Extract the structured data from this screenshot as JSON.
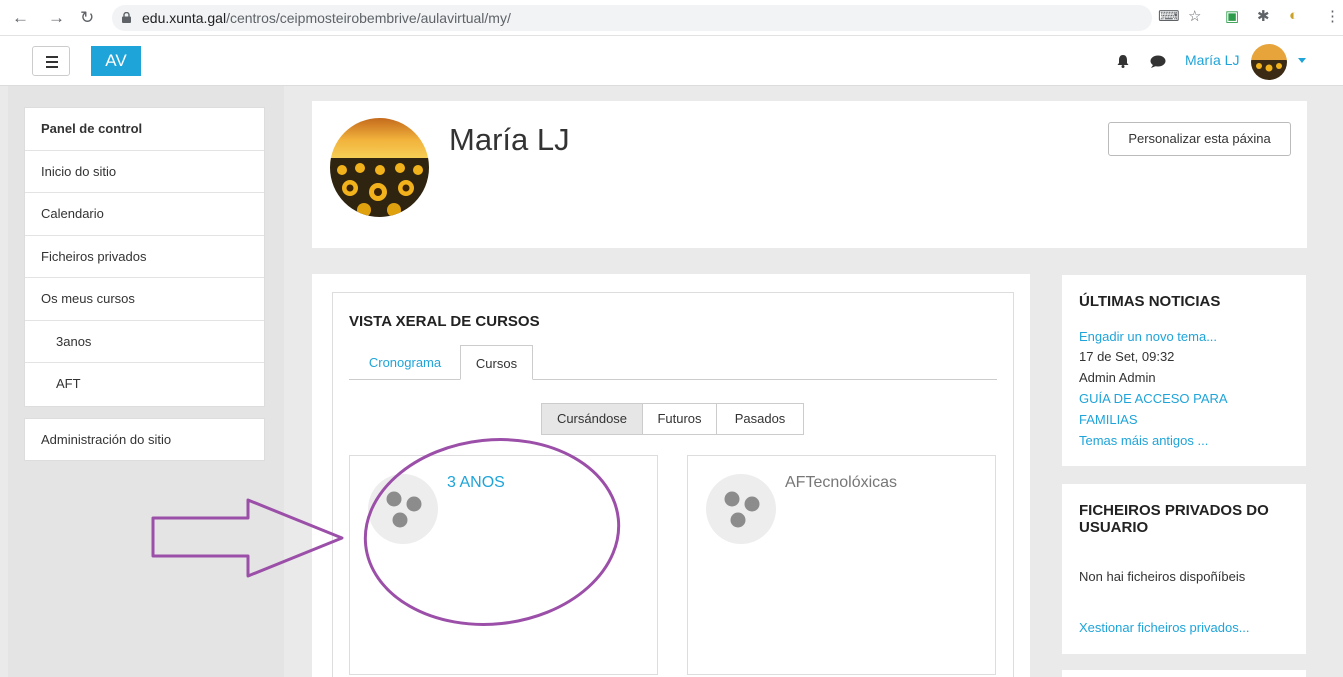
{
  "browser": {
    "url_domain": "edu.xunta.gal",
    "url_path": "/centros/ceipmosteirobembrive/aulavirtual/my/"
  },
  "navbar": {
    "brand": "AV",
    "user_name": "María LJ"
  },
  "sidebar": {
    "items": [
      {
        "label": "Panel de control"
      },
      {
        "label": "Inicio do sitio"
      },
      {
        "label": "Calendario"
      },
      {
        "label": "Ficheiros privados"
      },
      {
        "label": "Os meus cursos"
      },
      {
        "label": "3anos"
      },
      {
        "label": "AFT"
      }
    ],
    "admin": "Administración do sitio"
  },
  "header": {
    "full_name": "María LJ",
    "customize_button": "Personalizar esta páxina"
  },
  "course_overview": {
    "title": "VISTA XERAL DE CURSOS",
    "tabs": [
      {
        "label": "Cronograma"
      },
      {
        "label": "Cursos"
      }
    ],
    "filters": [
      {
        "label": "Cursándose"
      },
      {
        "label": "Futuros"
      },
      {
        "label": "Pasados"
      }
    ],
    "courses": [
      {
        "name": "3 ANOS"
      },
      {
        "name": "AFTecnolóxicas"
      }
    ]
  },
  "news": {
    "title": "ÚLTIMAS NOTICIAS",
    "add_topic": "Engadir un novo tema...",
    "post_date": "17 de Set, 09:32",
    "post_author": "Admin Admin",
    "post_title_line1": "GUÍA DE ACCESO PARA",
    "post_title_line2": "FAMILIAS",
    "older": "Temas máis antigos ..."
  },
  "private_files": {
    "title_line1": "FICHEIROS PRIVADOS DO",
    "title_line2": "USUARIO",
    "empty": "Non hai ficheiros dispoñíbeis",
    "manage": "Xestionar ficheiros privados..."
  },
  "colors": {
    "accent": "#1fa4d9",
    "annotation": "#9b4fa8"
  }
}
